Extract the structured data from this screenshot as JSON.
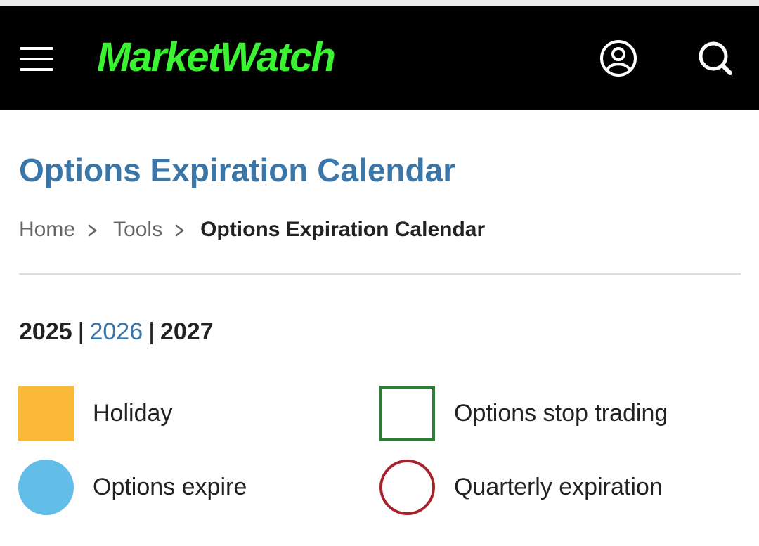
{
  "header": {
    "logo": "MarketWatch",
    "icons": {
      "menu": "menu-icon",
      "account": "account-icon",
      "search": "search-icon"
    },
    "brand_color": "#3bf233",
    "background": "#000000"
  },
  "page": {
    "title": "Options Expiration Calendar",
    "title_color": "#3a77a8"
  },
  "breadcrumb": {
    "items": [
      "Home",
      "Tools"
    ],
    "current": "Options Expiration Calendar"
  },
  "years": {
    "items": [
      "2025",
      "2026",
      "2027"
    ],
    "separator": "|",
    "selected": "2026"
  },
  "legend": {
    "holiday": {
      "label": "Holiday",
      "color": "#fbb93a"
    },
    "stop_trading": {
      "label": "Options stop trading",
      "color": "#2e7d32"
    },
    "expire": {
      "label": "Options expire",
      "color": "#63bde9"
    },
    "quarterly": {
      "label": "Quarterly expiration",
      "color": "#a8222b"
    }
  }
}
